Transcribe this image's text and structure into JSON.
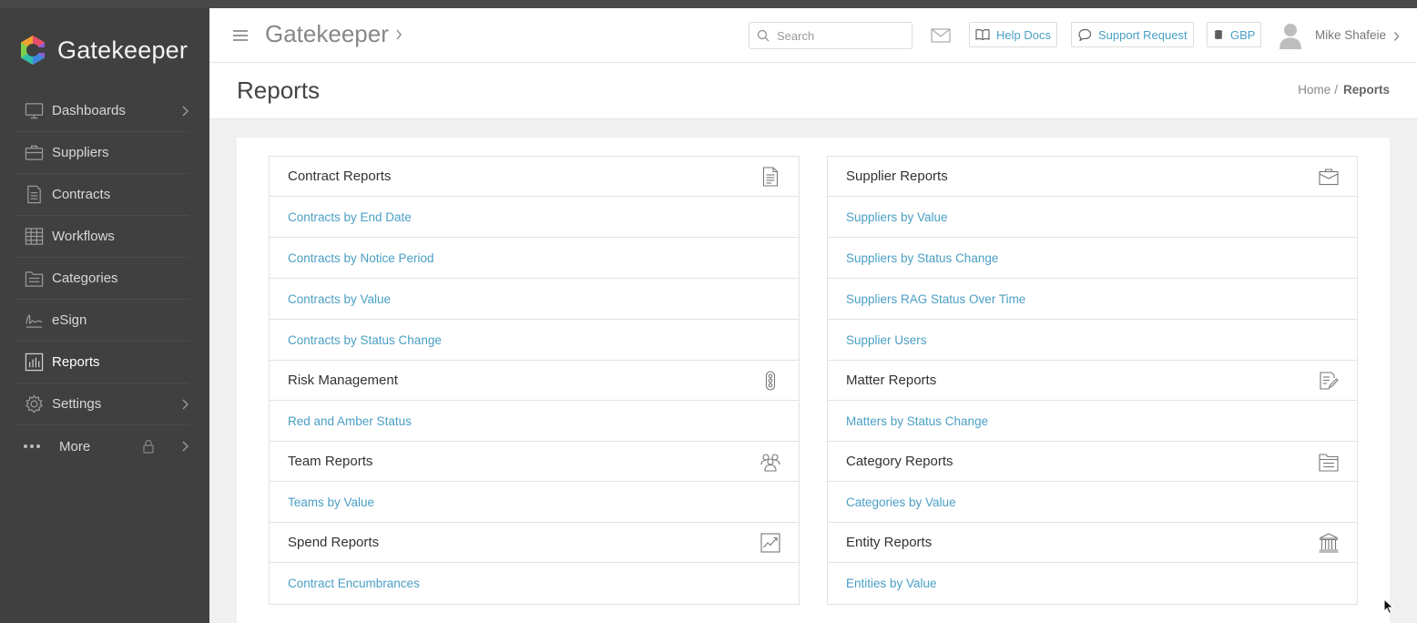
{
  "brand": {
    "name": "Gatekeeper",
    "colors": {
      "sidebar": "#404040",
      "link": "#4a9fc4",
      "header_bg": "#ffffff"
    }
  },
  "sidebar": {
    "items": [
      {
        "label": "Dashboards",
        "icon": "monitor-icon",
        "has_submenu": true
      },
      {
        "label": "Suppliers",
        "icon": "briefcase-icon"
      },
      {
        "label": "Contracts",
        "icon": "document-icon"
      },
      {
        "label": "Workflows",
        "icon": "grid-icon"
      },
      {
        "label": "Categories",
        "icon": "cabinet-icon"
      },
      {
        "label": "eSign",
        "icon": "signature-icon"
      },
      {
        "label": "Reports",
        "icon": "bar-chart-icon",
        "active": true
      },
      {
        "label": "Settings",
        "icon": "gear-icon",
        "has_submenu": true
      },
      {
        "label": "More",
        "icon": "dots-icon",
        "locked": true,
        "has_submenu": true
      }
    ]
  },
  "header": {
    "title": "Gatekeeper",
    "search_placeholder": "Search",
    "help_docs": "Help Docs",
    "support_request": "Support Request",
    "currency": "GBP",
    "user_name": "Mike Shafeie"
  },
  "page": {
    "title": "Reports",
    "breadcrumb": {
      "home": "Home",
      "separator": "/",
      "current": "Reports"
    }
  },
  "left_column": [
    {
      "title": "Contract Reports",
      "icon": "document-icon",
      "links": [
        "Contracts by End Date",
        "Contracts by Notice Period",
        "Contracts by Value",
        "Contracts by Status Change"
      ]
    },
    {
      "title": "Risk Management",
      "icon": "traffic-light-icon",
      "links": [
        "Red and Amber Status"
      ]
    },
    {
      "title": "Team Reports",
      "icon": "team-icon",
      "links": [
        "Teams by Value"
      ]
    },
    {
      "title": "Spend Reports",
      "icon": "trend-chart-icon",
      "links": [
        "Contract Encumbrances"
      ]
    }
  ],
  "right_column": [
    {
      "title": "Supplier Reports",
      "icon": "briefcase-icon",
      "links": [
        "Suppliers by Value",
        "Suppliers by Status Change",
        "Suppliers RAG Status Over Time",
        "Supplier Users"
      ]
    },
    {
      "title": "Matter Reports",
      "icon": "edit-document-icon",
      "links": [
        "Matters by Status Change"
      ]
    },
    {
      "title": "Category Reports",
      "icon": "cabinet-icon",
      "links": [
        "Categories by Value"
      ]
    },
    {
      "title": "Entity Reports",
      "icon": "bank-icon",
      "links": [
        "Entities by Value"
      ]
    }
  ]
}
